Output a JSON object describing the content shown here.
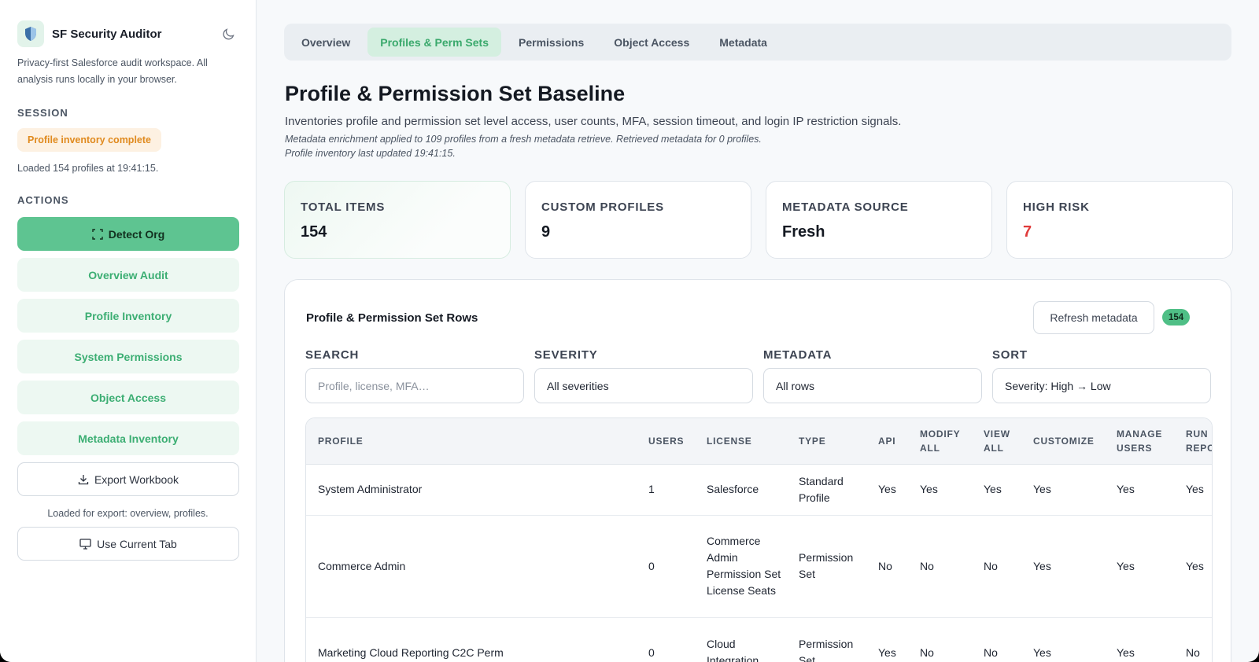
{
  "app": {
    "title": "SF Security Auditor",
    "description": "Privacy-first Salesforce audit workspace. All analysis runs locally in your browser."
  },
  "session": {
    "label": "SESSION",
    "status": "Profile inventory complete",
    "note": "Loaded 154 profiles at 19:41:15."
  },
  "actions": {
    "label": "ACTIONS",
    "detect_org": "Detect Org",
    "overview_audit": "Overview Audit",
    "profile_inventory": "Profile Inventory",
    "system_permissions": "System Permissions",
    "object_access": "Object Access",
    "metadata_inventory": "Metadata Inventory",
    "export_workbook": "Export Workbook",
    "export_note": "Loaded for export: overview, profiles.",
    "use_current_tab": "Use Current Tab"
  },
  "tabs": [
    {
      "label": "Overview",
      "active": false
    },
    {
      "label": "Profiles & Perm Sets",
      "active": true
    },
    {
      "label": "Permissions",
      "active": false
    },
    {
      "label": "Object Access",
      "active": false
    },
    {
      "label": "Metadata",
      "active": false
    }
  ],
  "page": {
    "title": "Profile & Permission Set Baseline",
    "subtitle": "Inventories profile and permission set level access, user counts, MFA, session timeout, and login IP restriction signals.",
    "note1": "Metadata enrichment applied to 109 profiles from a fresh metadata retrieve. Retrieved metadata for 0 profiles.",
    "note2": "Profile inventory last updated 19:41:15."
  },
  "stats": [
    {
      "label": "Total Items",
      "value": "154"
    },
    {
      "label": "Custom Profiles",
      "value": "9"
    },
    {
      "label": "Metadata Source",
      "value": "Fresh"
    },
    {
      "label": "High Risk",
      "value": "7"
    }
  ],
  "colors": {
    "accent": "#5ec491",
    "risk": "#e03a3a",
    "warning": "#e08a1e"
  },
  "panel": {
    "title": "Profile & Permission Set Rows",
    "refresh_label": "Refresh metadata",
    "count": "154",
    "filters": {
      "search_label": "Search",
      "search_placeholder": "Profile, license, MFA…",
      "severity_label": "Severity",
      "severity_value": "All severities",
      "metadata_label": "Metadata",
      "metadata_value": "All rows",
      "sort_label": "Sort",
      "sort_value": "Severity: High → Low"
    }
  },
  "table": {
    "headers": [
      "Profile",
      "Users",
      "License",
      "Type",
      "API",
      "Modify All",
      "View All",
      "Customize",
      "Manage Users",
      "Run Reports"
    ],
    "rows": [
      [
        "System Administrator",
        "1",
        "Salesforce",
        "Standard Profile",
        "Yes",
        "Yes",
        "Yes",
        "Yes",
        "Yes",
        "Yes"
      ],
      [
        "Commerce Admin",
        "0",
        "Commerce Admin Permission Set License Seats",
        "Permission Set",
        "No",
        "No",
        "No",
        "Yes",
        "Yes",
        "Yes"
      ],
      [
        "Marketing Cloud Reporting C2C Perm",
        "0",
        "Cloud Integration",
        "Permission Set",
        "Yes",
        "No",
        "No",
        "Yes",
        "Yes",
        "No"
      ]
    ]
  }
}
